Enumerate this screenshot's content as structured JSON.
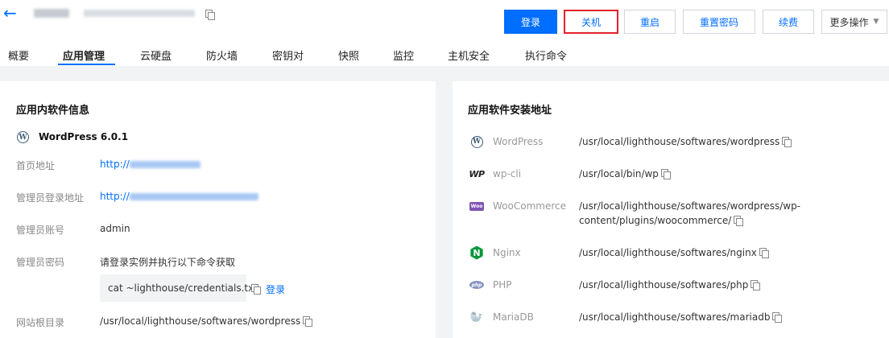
{
  "header": {
    "buttons": {
      "login": "登录",
      "shutdown": "关机",
      "restart": "重启",
      "reset_password": "重置密码",
      "renew": "续费",
      "more": "更多操作"
    }
  },
  "tabs": [
    "概要",
    "应用管理",
    "云硬盘",
    "防火墙",
    "密钥对",
    "快照",
    "监控",
    "主机安全",
    "执行命令"
  ],
  "left_card": {
    "title": "应用内软件信息",
    "app_version": "WordPress 6.0.1",
    "fields": {
      "home_label": "首页地址",
      "home_prefix": "http://",
      "admin_login_label": "管理员登录地址",
      "admin_login_prefix": "http://",
      "admin_account_label": "管理员账号",
      "admin_account_value": "admin",
      "admin_password_label": "管理员密码",
      "admin_password_hint": "请登录实例并执行以下命令获取",
      "command": "cat ~lighthouse/credentials.txt",
      "command_login": "登录",
      "webroot_label": "网站根目录",
      "webroot_value": "/usr/local/lighthouse/softwares/wordpress"
    }
  },
  "right_card": {
    "title": "应用软件安装地址",
    "software": [
      {
        "name": "WordPress",
        "icon": "wordpress-icon",
        "path": "/usr/local/lighthouse/softwares/wordpress"
      },
      {
        "name": "wp-cli",
        "icon": "wp-cli-icon",
        "path": "/usr/local/bin/wp"
      },
      {
        "name": "WooCommerce",
        "icon": "woocommerce-icon",
        "path": "/usr/local/lighthouse/softwares/wordpress/wp-content/plugins/woocommerce/"
      },
      {
        "name": "Nginx",
        "icon": "nginx-icon",
        "path": "/usr/local/lighthouse/softwares/nginx"
      },
      {
        "name": "PHP",
        "icon": "php-icon",
        "path": "/usr/local/lighthouse/softwares/php"
      },
      {
        "name": "MariaDB",
        "icon": "mariadb-icon",
        "path": "/usr/local/lighthouse/softwares/mariadb"
      }
    ]
  },
  "colors": {
    "accent": "#006eff",
    "highlight_border": "#e5202b"
  }
}
